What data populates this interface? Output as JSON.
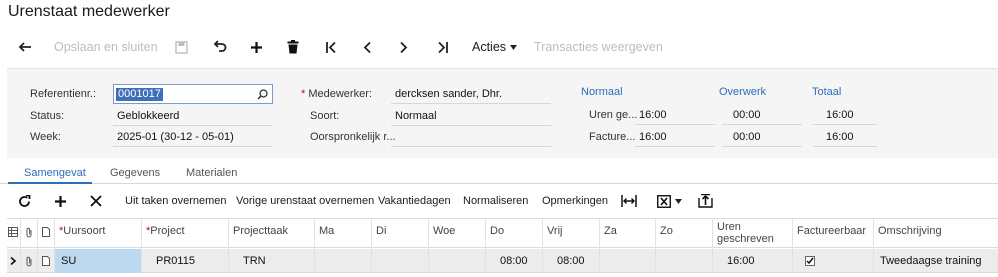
{
  "page": {
    "title": "Urenstaat medewerker"
  },
  "toolbar": {
    "save_close_label": "Opslaan en sluiten",
    "actions_label": "Acties",
    "transactions_label": "Transacties weergeven"
  },
  "form": {
    "reference": {
      "label": "Referentienr.:",
      "value": "0001017"
    },
    "status": {
      "label": "Status:",
      "value": "Geblokkeerd"
    },
    "week": {
      "label": "Week:",
      "value": "2025-01 (30-12 - 05-01)"
    },
    "employee": {
      "required_mark": "*",
      "label": "Medewerker:",
      "value": "dercksen sander, Dhr."
    },
    "type": {
      "label": "Soort:",
      "value": "Normaal"
    },
    "original_ref": {
      "label": "Oorspronkelijk r...",
      "value": ""
    },
    "columns": {
      "normal": "Normaal",
      "overtime": "Overwerk",
      "total": "Totaal"
    },
    "hours_row": {
      "label": "Uren ge...",
      "normal": "16:00",
      "overtime": "00:00",
      "total": "16:00"
    },
    "invoiced_row": {
      "label": "Facture...",
      "normal": "16:00",
      "overtime": "00:00",
      "total": "16:00"
    }
  },
  "tabs": [
    "Samengevat",
    "Gegevens",
    "Materialen"
  ],
  "grid_toolbar": {
    "take_over_tasks": "Uit taken overnemen",
    "take_over_previous": "Vorige urenstaat overnemen",
    "vacation_days": "Vakantiedagen",
    "normalize": "Normaliseren",
    "remarks": "Opmerkingen"
  },
  "grid": {
    "columns": {
      "earning_type": "Uursoort",
      "project": "Project",
      "project_task": "Projecttaak",
      "mon": "Ma",
      "tue": "Di",
      "wed": "Woe",
      "thu": "Do",
      "fri": "Vrij",
      "sat": "Za",
      "sun": "Zo",
      "hours_written_1": "Uren",
      "hours_written_2": "geschreven",
      "billable": "Factureerbaar",
      "description": "Omschrijving"
    },
    "rows": [
      {
        "earning_type": "SU",
        "project": "PR0115",
        "project_task": "TRN",
        "mon": "",
        "tue": "",
        "wed": "",
        "thu": "08:00",
        "fri": "08:00",
        "sat": "",
        "sun": "",
        "hours_written": "16:00",
        "billable": true,
        "description": "Tweedaagse training"
      }
    ]
  },
  "colors": {
    "accent": "#2b6fb6",
    "selection": "#bcd9f0",
    "required": "#cc0000"
  }
}
